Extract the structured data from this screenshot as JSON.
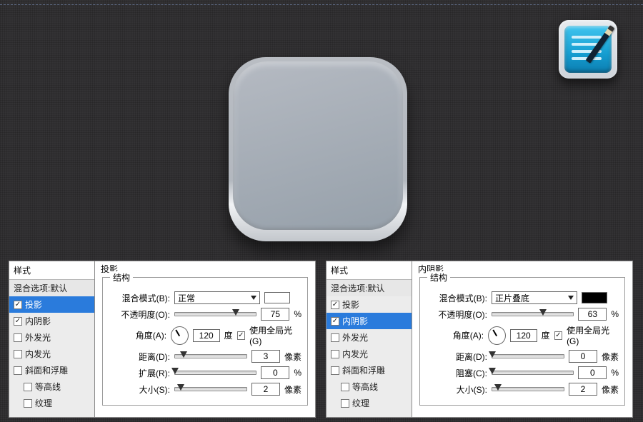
{
  "preview": {
    "name": "icon-preview-3d",
    "appicon": "notes-app-icon"
  },
  "styles_header": "样式",
  "blending_row": "混合选项:默认",
  "style_rows": [
    {
      "key": "drop-shadow",
      "label": "投影"
    },
    {
      "key": "inner-shadow",
      "label": "内阴影"
    },
    {
      "key": "outer-glow",
      "label": "外发光"
    },
    {
      "key": "inner-glow",
      "label": "内发光"
    },
    {
      "key": "bevel",
      "label": "斜面和浮雕"
    },
    {
      "key": "contour",
      "label": "等高线",
      "indent": true
    },
    {
      "key": "texture",
      "label": "纹理",
      "indent": true
    }
  ],
  "group_label": "结构",
  "labels": {
    "blend_mode": "混合模式(B):",
    "opacity": "不透明度(O):",
    "angle": "角度(A):",
    "degree": "度",
    "global_light": "使用全局光(G)",
    "distance": "距离(D):",
    "spread": "扩展(R):",
    "choke": "阻塞(C):",
    "size": "大小(S):",
    "px": "像素",
    "pct": "%"
  },
  "panels": [
    {
      "id": "drop-shadow-panel",
      "title": "投影",
      "selected_style": "drop-shadow",
      "checked_styles": [
        "drop-shadow",
        "inner-shadow"
      ],
      "blend_mode_value": "正常",
      "swatch": "sw-white",
      "opacity": 75,
      "angle": 120,
      "global_light": true,
      "distance": 3,
      "spread_label_key": "spread",
      "spread": 0,
      "size": 2
    },
    {
      "id": "inner-shadow-panel",
      "title": "内阴影",
      "selected_style": "inner-shadow",
      "checked_styles": [
        "drop-shadow",
        "inner-shadow"
      ],
      "blend_mode_value": "正片叠底",
      "swatch": "sw-black",
      "opacity": 63,
      "angle": 120,
      "global_light": true,
      "distance": 0,
      "spread_label_key": "choke",
      "spread": 0,
      "size": 2
    }
  ]
}
